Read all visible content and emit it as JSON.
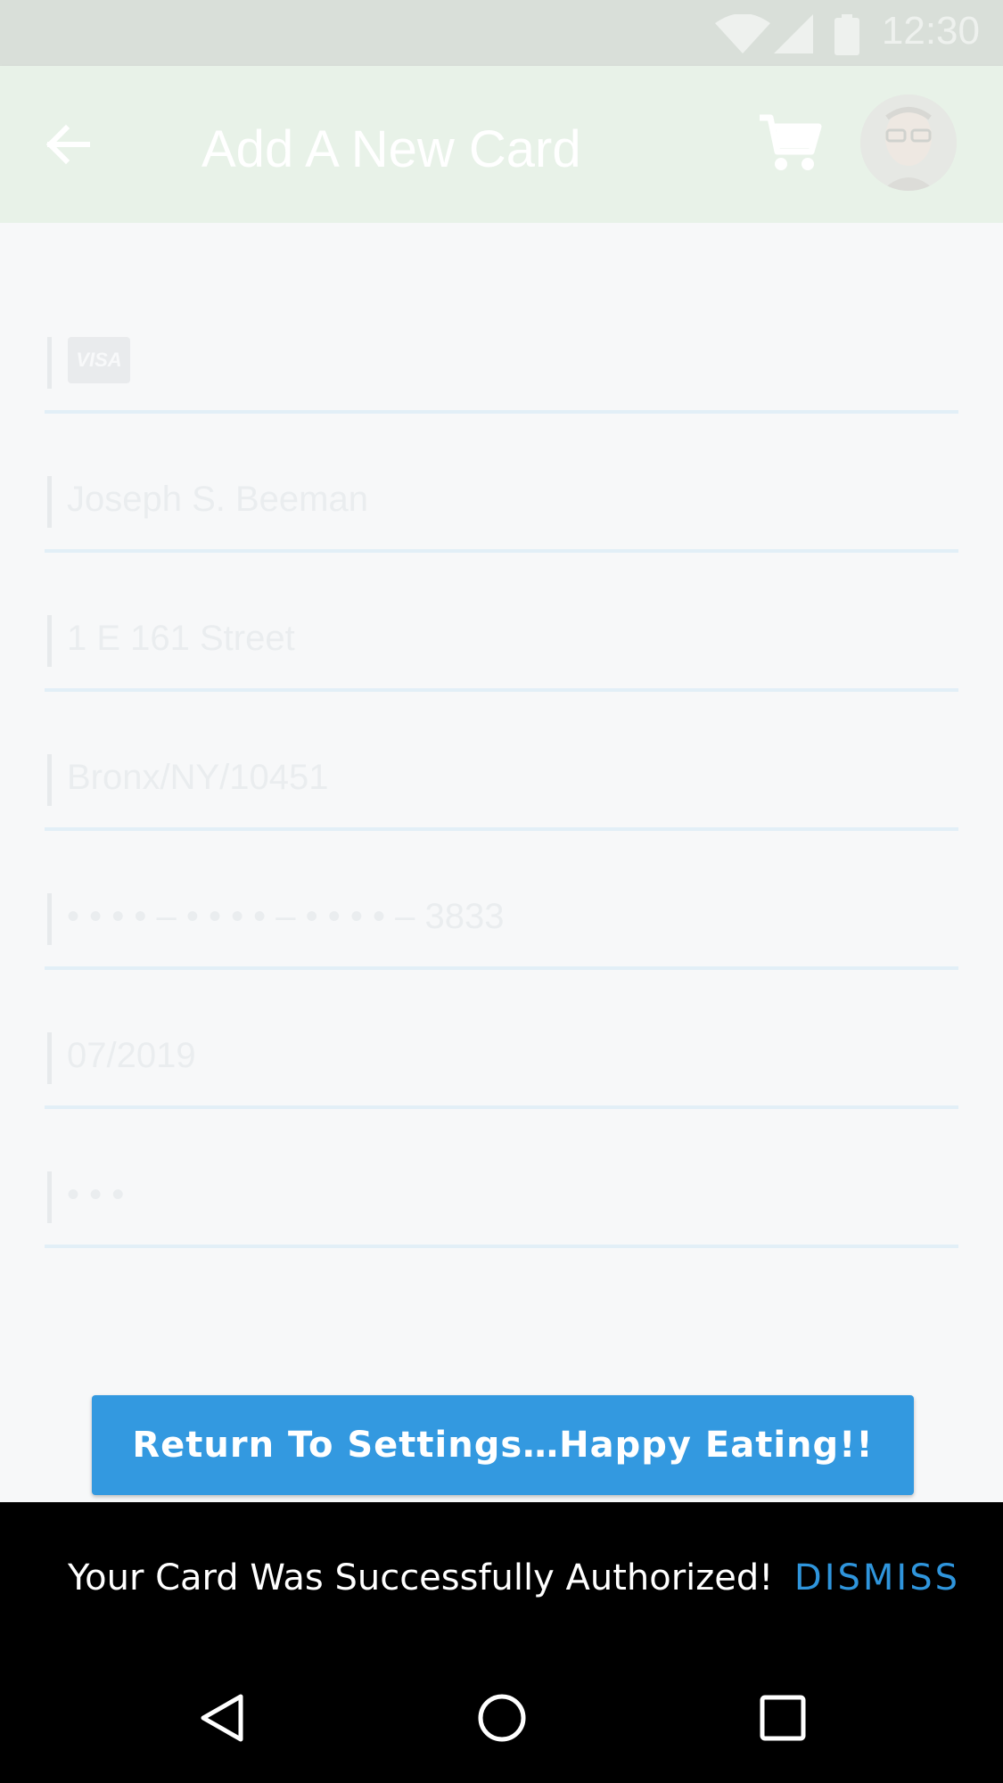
{
  "status_bar": {
    "time": "12:30",
    "icons": [
      "wifi-icon",
      "signal-icon",
      "battery-icon"
    ]
  },
  "app_bar": {
    "title": "Add A New Card",
    "back_icon": "arrow-left-icon",
    "cart_icon": "shopping-cart-icon",
    "avatar": "user-avatar"
  },
  "form": {
    "card_brand": "VISA",
    "name": "Joseph S. Beeman",
    "address": "1 E 161 Street",
    "city_state_zip": "Bronx/NY/10451",
    "card_number": "• • • • – • • • • – • • • • – 3833",
    "expiry": "07/2019",
    "cvv": "• • •"
  },
  "cta_label": "Return To Settings…Happy Eating!!",
  "snackbar": {
    "message": "Your Card Was Successfully Authorized!",
    "action": "DISMISS"
  },
  "nav_bar": {
    "icons": [
      "back-triangle-icon",
      "home-circle-icon",
      "recents-square-icon"
    ]
  },
  "colors": {
    "accent": "#3399e0",
    "dismiss": "#2f95dc",
    "appbar": "#e8f2e8"
  }
}
